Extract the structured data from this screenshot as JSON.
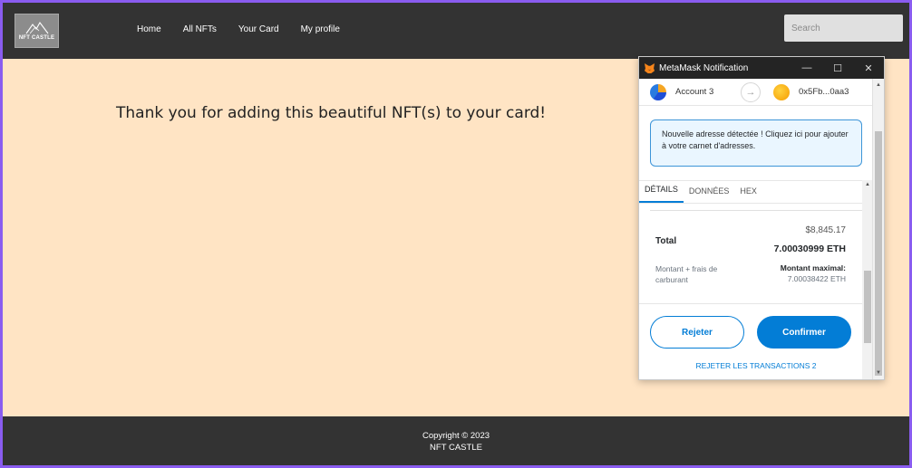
{
  "site": {
    "logo_text": "NFT CASTLE",
    "nav": [
      "Home",
      "All NFTs",
      "Your Card",
      "My profile"
    ],
    "search_placeholder": "Search",
    "message": "Thank you for adding this beautiful NFT(s) to your card!",
    "footer_line1": "Copyright © 2023",
    "footer_line2": "NFT CASTLE"
  },
  "metamask": {
    "title": "MetaMask Notification",
    "window_buttons": [
      "—",
      "☐",
      "✕"
    ],
    "from_account": "Account 3",
    "to_address": "0x5Fb...0aa3",
    "notice": "Nouvelle adresse détectée ! Cliquez ici pour ajouter à votre carnet d'adresses.",
    "tabs": [
      "DÉTAILS",
      "DONNÉES",
      "HEX"
    ],
    "usd_total": "$8,845.17",
    "total_label": "Total",
    "eth_total": "7.00030999 ETH",
    "fee_label": "Montant + frais de carburant",
    "max_label": "Montant maximal:",
    "max_value": "7.00038422 ETH",
    "reject_button": "Rejeter",
    "confirm_button": "Confirmer",
    "reject_all": "REJETER LES TRANSACTIONS 2"
  },
  "colors": {
    "page_bg": "#ffe4c4",
    "navbar_bg": "#333333",
    "metamask_blue": "#037dd6"
  }
}
